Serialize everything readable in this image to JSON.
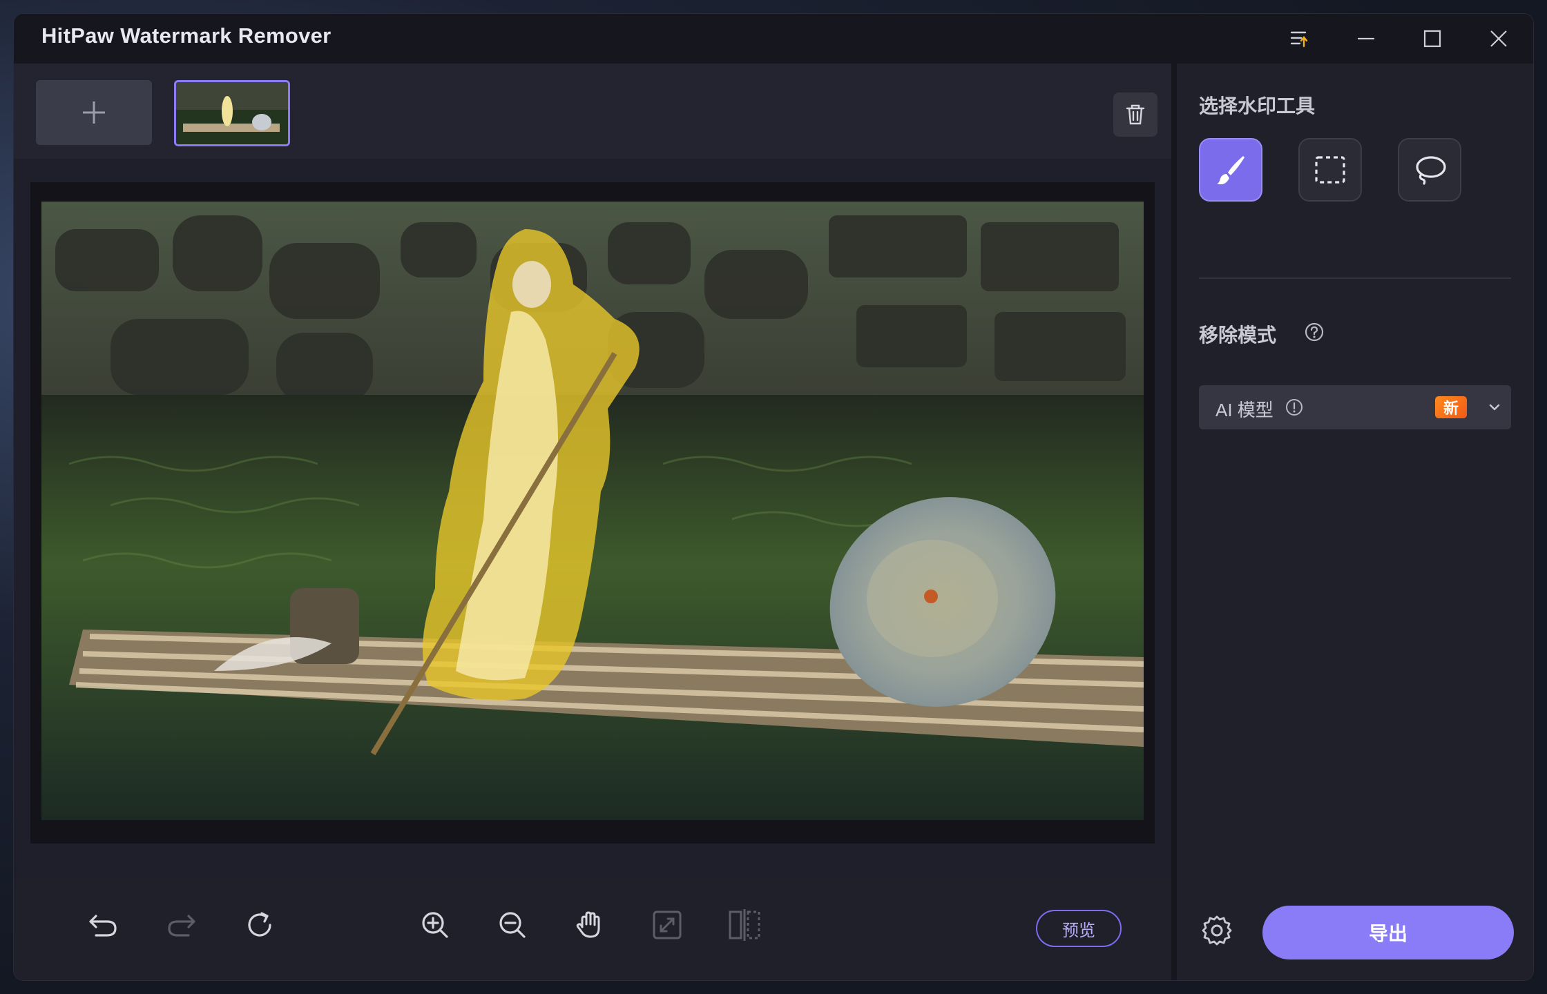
{
  "window": {
    "title": "HitPaw Watermark Remover"
  },
  "toolbar": {
    "preview_label": "预览"
  },
  "sidebar": {
    "tools_title": "选择水印工具",
    "mode_title": "移除模式",
    "mode_select": {
      "value": "AI 模型",
      "badge": "新"
    },
    "export_label": "导出"
  },
  "colors": {
    "accent": "#8a7cf6",
    "mask": "#e6c21f",
    "badge": "#f27a1a",
    "panel": "#1f2029"
  },
  "icons": {
    "titlebar": [
      "menu-icon",
      "minimize-icon",
      "maximize-icon",
      "close-icon"
    ],
    "tools": [
      "brush-icon",
      "rectangle-select-icon",
      "lasso-icon"
    ],
    "toolbar": [
      "undo-icon",
      "redo-icon",
      "reset-icon",
      "zoom-in-icon",
      "zoom-out-icon",
      "hand-icon",
      "fit-screen-icon",
      "compare-icon"
    ]
  }
}
